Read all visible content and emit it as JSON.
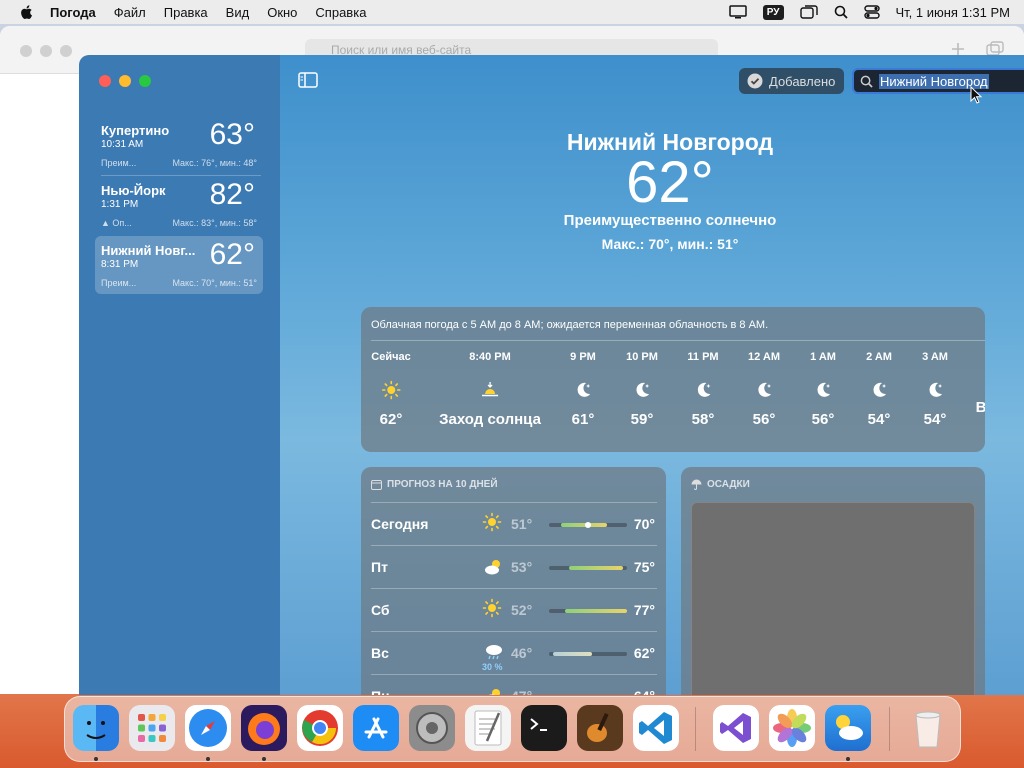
{
  "menubar": {
    "app": "Погода",
    "items": [
      "Файл",
      "Правка",
      "Вид",
      "Окно",
      "Справка"
    ],
    "lang": "РУ",
    "clock": "Чт, 1 июня  1:31 PM"
  },
  "safari": {
    "url_placeholder": "Поиск или имя веб-сайта"
  },
  "sidebar": {
    "cities": [
      {
        "name": "Купертино",
        "time": "10:31 AM",
        "temp": "63°",
        "cond": "Преим...",
        "hilo": "Макс.: 76°, мин.: 48°"
      },
      {
        "name": "Нью-Йорк",
        "time": "1:31 PM",
        "temp": "82°",
        "cond": "Оп...",
        "hilo": "Макс.: 83°, мин.: 58°"
      },
      {
        "name": "Нижний Новг...",
        "time": "8:31 PM",
        "temp": "62°",
        "cond": "Преим...",
        "hilo": "Макс.: 70°, мин.: 51°"
      }
    ]
  },
  "toolbar": {
    "added_label": "Добавлено",
    "search_value": "Нижний Новгород"
  },
  "current": {
    "city": "Нижний Новгород",
    "temp": "62°",
    "condition": "Преимущественно солнечно",
    "hilo": "Макс.: 70°, мин.: 51°"
  },
  "hourly": {
    "summary": "Облачная погода с 5 AM до 8 AM; ожидается переменная облачность в 8 AM.",
    "hours": [
      {
        "label": "Сейчас",
        "icon": "sun-icon",
        "temp": "62°"
      },
      {
        "label": "8:40 PM",
        "icon": "sunset-icon",
        "temp": "Заход солнца"
      },
      {
        "label": "9 PM",
        "icon": "moon-icon",
        "temp": "61°"
      },
      {
        "label": "10 PM",
        "icon": "moon-icon",
        "temp": "59°"
      },
      {
        "label": "11 PM",
        "icon": "moon-icon",
        "temp": "58°"
      },
      {
        "label": "12 AM",
        "icon": "moon-icon",
        "temp": "56°"
      },
      {
        "label": "1 AM",
        "icon": "moon-icon",
        "temp": "56°"
      },
      {
        "label": "2 AM",
        "icon": "moon-icon",
        "temp": "54°"
      },
      {
        "label": "3 AM",
        "icon": "moon-icon",
        "temp": "54°"
      },
      {
        "label": "",
        "icon": "",
        "temp": "В"
      }
    ]
  },
  "forecast": {
    "title": "ПРОГНОЗ НА 10 ДНЕЙ",
    "days": [
      {
        "day": "Сегодня",
        "icon": "sun-icon",
        "pct": "",
        "lo": "51°",
        "hi": "70°",
        "range": [
          0.15,
          0.75
        ],
        "current": 0.5
      },
      {
        "day": "Пт",
        "icon": "partly-cloudy-icon",
        "pct": "",
        "lo": "53°",
        "hi": "75°",
        "range": [
          0.25,
          0.95
        ]
      },
      {
        "day": "Сб",
        "icon": "sun-icon",
        "pct": "",
        "lo": "52°",
        "hi": "77°",
        "range": [
          0.2,
          1.0
        ]
      },
      {
        "day": "Вс",
        "icon": "rain-cloud-icon",
        "pct": "30 %",
        "lo": "46°",
        "hi": "62°",
        "range": [
          0.05,
          0.55
        ]
      },
      {
        "day": "Пн",
        "icon": "partly-cloudy-icon",
        "pct": "",
        "lo": "47°",
        "hi": "64°",
        "range": [
          0.1,
          0.6
        ]
      }
    ]
  },
  "precipitation": {
    "title": "ОСАДКИ"
  }
}
